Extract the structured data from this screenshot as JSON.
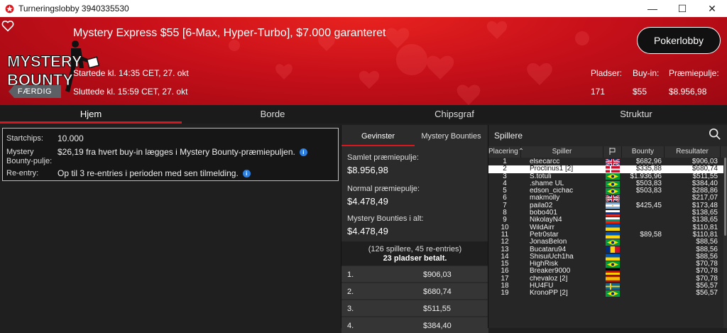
{
  "window": {
    "title": "Turneringslobby 3940335530"
  },
  "banner": {
    "logo_text_top": "MYSTERY",
    "logo_text_bottom": "BOUNTY",
    "event_title": "Mystery Express $55 [6-Max, Hyper-Turbo], $7.000 garanteret",
    "started": "Startede kl. 14:35 CET, 27. okt",
    "ended": "Sluttede kl. 15:59 CET, 27. okt",
    "status_badge": "FÆRDIG",
    "lobby_button": "Pokerlobby",
    "stats": [
      {
        "label": "Pladser:",
        "value": "171"
      },
      {
        "label": "Buy-in:",
        "value": "$55"
      },
      {
        "label": "Præmiepulje:",
        "value": "$8.956,98"
      }
    ],
    "colors": {
      "red": "#d9161c"
    }
  },
  "tabs": [
    "Hjem",
    "Borde",
    "Chipsgraf",
    "Struktur"
  ],
  "info": {
    "startchips_label": "Startchips:",
    "startchips_value": "10.000",
    "bounty_label_1": "Mystery",
    "bounty_label_2": "Bounty-pulje:",
    "bounty_value": "$26,19 fra hvert buy-in lægges i Mystery Bounty-præmiepuljen.",
    "reentry_label": "Re-entry:",
    "reentry_value": "Op til 3 re-entries i perioden med sen tilmelding.",
    "info_icon": "i"
  },
  "prizes": {
    "tabs": [
      "Gevinster",
      "Mystery Bounties"
    ],
    "total_label": "Samlet præmiepulje:",
    "total_value": "$8.956,98",
    "normal_label": "Normal præmiepulje:",
    "normal_value": "$4.478,49",
    "bounties_label": "Mystery Bounties i alt:",
    "bounties_value": "$4.478,49",
    "summary_line1": "(126 spillere, 45 re-entries)",
    "summary_line2": "23 pladser betalt.",
    "payouts": [
      {
        "pos": "1.",
        "amount": "$906,03"
      },
      {
        "pos": "2.",
        "amount": "$680,74"
      },
      {
        "pos": "3.",
        "amount": "$511,55"
      },
      {
        "pos": "4.",
        "amount": "$384,40"
      }
    ]
  },
  "players": {
    "title": "Spillere",
    "columns": [
      "Placering",
      "Spiller",
      "",
      "Bounty",
      "Resultater"
    ],
    "rows": [
      {
        "rank": "1",
        "name": "elsecarcc",
        "flag": "gb",
        "bounty": "$682,96",
        "result": "$906,03"
      },
      {
        "rank": "2",
        "name": "Proctinus1 [2]",
        "flag": "dk",
        "bounty": "$335,88",
        "result": "$680,74"
      },
      {
        "rank": "3",
        "name": "S.totuli",
        "flag": "br",
        "bounty": "$1.936,96",
        "result": "$511,55"
      },
      {
        "rank": "4",
        "name": ".shame UL",
        "flag": "br",
        "bounty": "$503,83",
        "result": "$384,40"
      },
      {
        "rank": "5",
        "name": "edson_cichac",
        "flag": "br",
        "bounty": "$503,83",
        "result": "$288,86"
      },
      {
        "rank": "6",
        "name": "makmolly",
        "flag": "gb",
        "bounty": "",
        "result": "$217,07"
      },
      {
        "rank": "7",
        "name": "paila02",
        "flag": "ar",
        "bounty": "$425,45",
        "result": "$173,48"
      },
      {
        "rank": "8",
        "name": "bobo401",
        "flag": "ru",
        "bounty": "",
        "result": "$138,65"
      },
      {
        "rank": "9",
        "name": "NikolayN4",
        "flag": "bg",
        "bounty": "",
        "result": "$138,65"
      },
      {
        "rank": "10",
        "name": "WildAirr",
        "flag": "ua",
        "bounty": "",
        "result": "$110,81"
      },
      {
        "rank": "11",
        "name": "Petr0star",
        "flag": "ua",
        "bounty": "$89,58",
        "result": "$110,81"
      },
      {
        "rank": "12",
        "name": "JonasBelon",
        "flag": "br",
        "bounty": "",
        "result": "$88,56"
      },
      {
        "rank": "13",
        "name": "Bucataru94",
        "flag": "ro",
        "bounty": "",
        "result": "$88,56"
      },
      {
        "rank": "14",
        "name": "ShisuiUch1ha",
        "flag": "ua",
        "bounty": "",
        "result": "$88,56"
      },
      {
        "rank": "15",
        "name": "HighRisk",
        "flag": "br",
        "bounty": "",
        "result": "$70,78"
      },
      {
        "rank": "16",
        "name": "Breaker9000",
        "flag": "de",
        "bounty": "",
        "result": "$70,78"
      },
      {
        "rank": "17",
        "name": "chevaloz [2]",
        "flag": "es",
        "bounty": "",
        "result": "$70,78"
      },
      {
        "rank": "18",
        "name": "HU4FU",
        "flag": "se",
        "bounty": "",
        "result": "$56,57"
      },
      {
        "rank": "19",
        "name": "KronoPP [2]",
        "flag": "br",
        "bounty": "",
        "result": "$56,57"
      }
    ]
  }
}
